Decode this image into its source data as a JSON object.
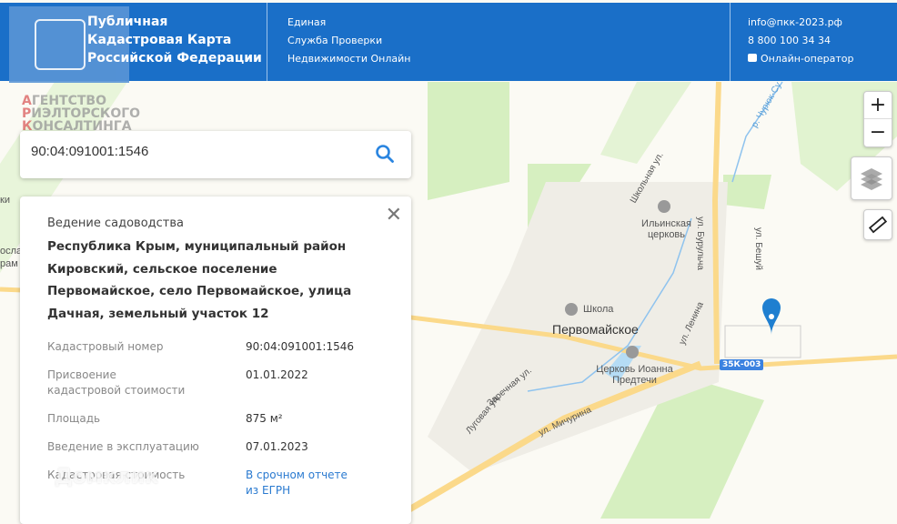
{
  "header": {
    "title_lines": [
      "Публичная",
      "Кадастровая Карта",
      "Российской Федерации"
    ],
    "subtitle_lines": [
      "Единая",
      "Служба Проверки",
      "Недвижимости Онлайн"
    ],
    "email": "info@пкк-2023.рф",
    "phone": "8 800 100 34 34",
    "chat": "Онлайн-оператор"
  },
  "watermark": {
    "line1_first": "А",
    "line1_rest": "ГЕНТСТВО",
    "line2_first": "Р",
    "line2_rest": "ИЭЛТОРСКОГО",
    "line3_first": "К",
    "line3_rest": "ОНСАЛТИНГА"
  },
  "search": {
    "value": "90:04:091001:1546"
  },
  "panel": {
    "type": "Ведение садоводства",
    "address": "Республика Крым, муниципальный район Кировский, сельское поселение Первомайское, село Первомайское, улица Дачная, земельный участок 12",
    "rows": [
      {
        "k": "Кадастровый номер",
        "v": "90:04:091001:1546"
      },
      {
        "k": "Присвоение кадастровой стоимости",
        "v": "01.01.2022"
      },
      {
        "k": "Площадь",
        "v": "875 м²"
      },
      {
        "k": "Введение в эксплуатацию",
        "v": "07.01.2023"
      },
      {
        "k": "Кадастровая стоимость",
        "v": "В срочном отчете из ЕГРН"
      }
    ]
  },
  "map": {
    "village": "Первомайское",
    "school": "Школа",
    "church1": "Ильинская церковь",
    "church2": "Церковь Иоанна Предтечи",
    "street1": "ул. Бурульча",
    "street2": "ул. Бешуй",
    "street3": "ул. Ленина",
    "street4": "ул. Мичурина",
    "street5": "Школьная ул.",
    "street6": "Заречная ул.",
    "street7": "Луговая ул.",
    "river": "р. Чурюк-Су",
    "road": "35К-003",
    "left1": "ки",
    "left2": "ослав",
    "left3": "рам",
    "domklik": "Домклик"
  },
  "controls": {
    "zoom_in": "+",
    "zoom_out": "−"
  }
}
